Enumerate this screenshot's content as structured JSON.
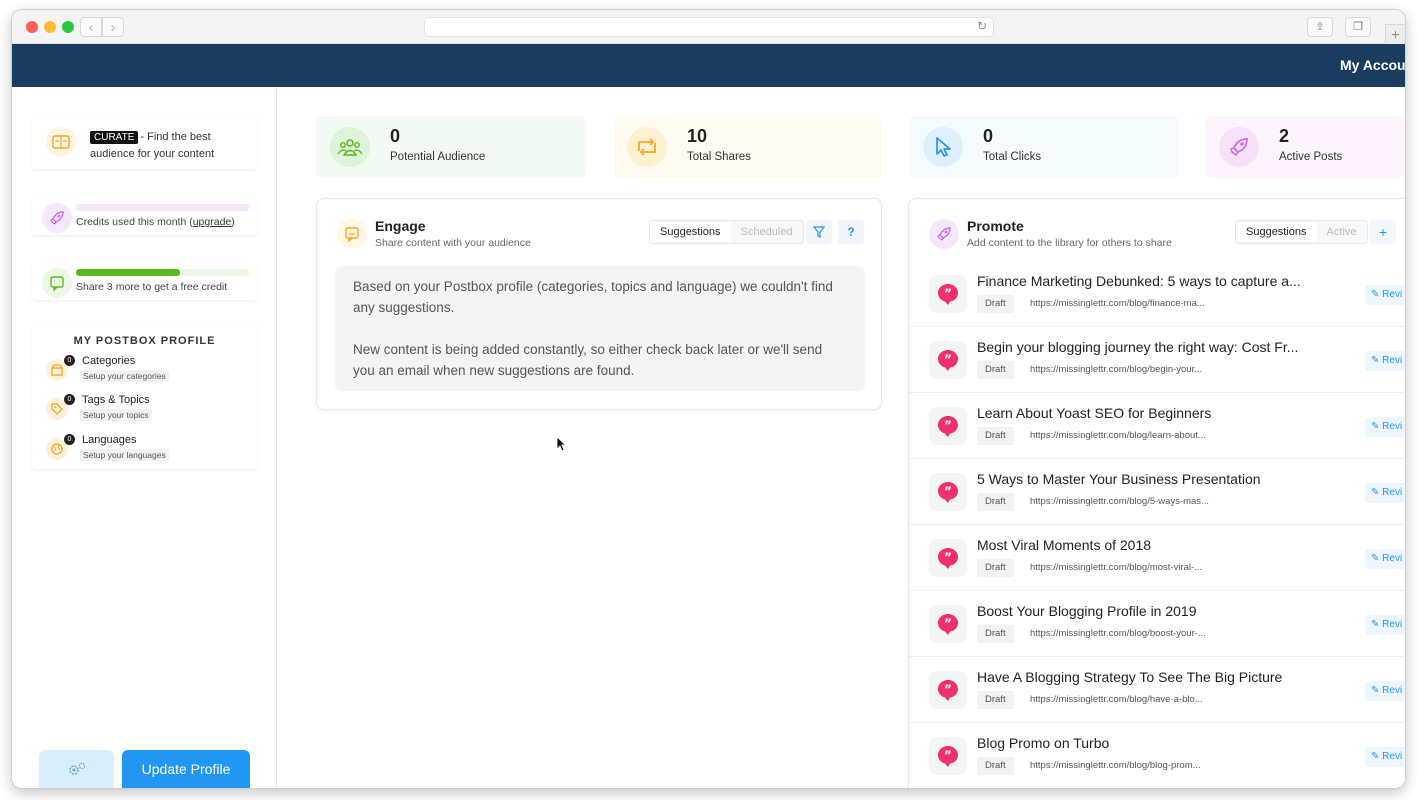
{
  "app": {
    "account_label": "My Accou"
  },
  "sidebar": {
    "curate": {
      "badge": "CURATE",
      "text": "- Find the best audience for your content"
    },
    "credits": {
      "label_prefix": "Credits used this month (",
      "link": "upgrade",
      "label_suffix": ")",
      "progress": 0
    },
    "share": {
      "label": "Share 3 more to get a free credit",
      "progress": 0.6
    },
    "profile": {
      "title": "MY POSTBOX PROFILE",
      "items": [
        {
          "name": "Categories",
          "sub": "Setup your categories",
          "count": "0"
        },
        {
          "name": "Tags & Topics",
          "sub": "Setup your topics",
          "count": "0"
        },
        {
          "name": "Languages",
          "sub": "Setup your languages",
          "count": "0"
        }
      ]
    },
    "update_label": "Update Profile"
  },
  "stats": [
    {
      "value": "0",
      "label": "Potential Audience"
    },
    {
      "value": "10",
      "label": "Total Shares"
    },
    {
      "value": "0",
      "label": "Total Clicks"
    },
    {
      "value": "2",
      "label": "Active Posts"
    }
  ],
  "engage": {
    "title": "Engage",
    "subtitle": "Share content with your audience",
    "tabs": [
      "Suggestions",
      "Scheduled"
    ],
    "empty_1": "Based on your Postbox profile (categories, topics and language) we couldn't find any suggestions.",
    "empty_2": "New content is being added constantly, so either check back later or we'll send you an email when new suggestions are found."
  },
  "promote": {
    "title": "Promote",
    "subtitle": "Add content to the library for others to share",
    "tabs": [
      "Suggestions",
      "Active"
    ],
    "add_label": "+",
    "posts": [
      {
        "title": "Finance Marketing Debunked: 5 ways to capture a...",
        "status": "Draft",
        "url": "https://missinglettr.com/blog/finance-ma...",
        "action": "Revi"
      },
      {
        "title": "Begin your blogging journey the right way: Cost Fr...",
        "status": "Draft",
        "url": "https://missinglettr.com/blog/begin-your...",
        "action": "Revi"
      },
      {
        "title": "Learn About Yoast SEO for Beginners",
        "status": "Draft",
        "url": "https://missinglettr.com/blog/learn-about...",
        "action": "Revi"
      },
      {
        "title": "5 Ways to Master Your Business Presentation",
        "status": "Draft",
        "url": "https://missinglettr.com/blog/5-ways-mas...",
        "action": "Revi"
      },
      {
        "title": "Most Viral Moments of 2018",
        "status": "Draft",
        "url": "https://missinglettr.com/blog/most-viral-...",
        "action": "Revi"
      },
      {
        "title": "Boost Your Blogging Profile in 2019",
        "status": "Draft",
        "url": "https://missinglettr.com/blog/boost-your-...",
        "action": "Revi"
      },
      {
        "title": "Have A Blogging Strategy To See The Big Picture",
        "status": "Draft",
        "url": "https://missinglettr.com/blog/have-a-blo...",
        "action": "Revi"
      },
      {
        "title": "Blog Promo on Turbo",
        "status": "Draft",
        "url": "https://missinglettr.com/blog/blog-prom...",
        "action": "Revi"
      }
    ]
  },
  "colors": {
    "header": "#1a3c5e",
    "primary": "#2196f3",
    "accent_pink": "#f0306c",
    "accent_green": "#59b81f",
    "accent_purple": "#c66ee6",
    "accent_orange": "#f5a623"
  }
}
